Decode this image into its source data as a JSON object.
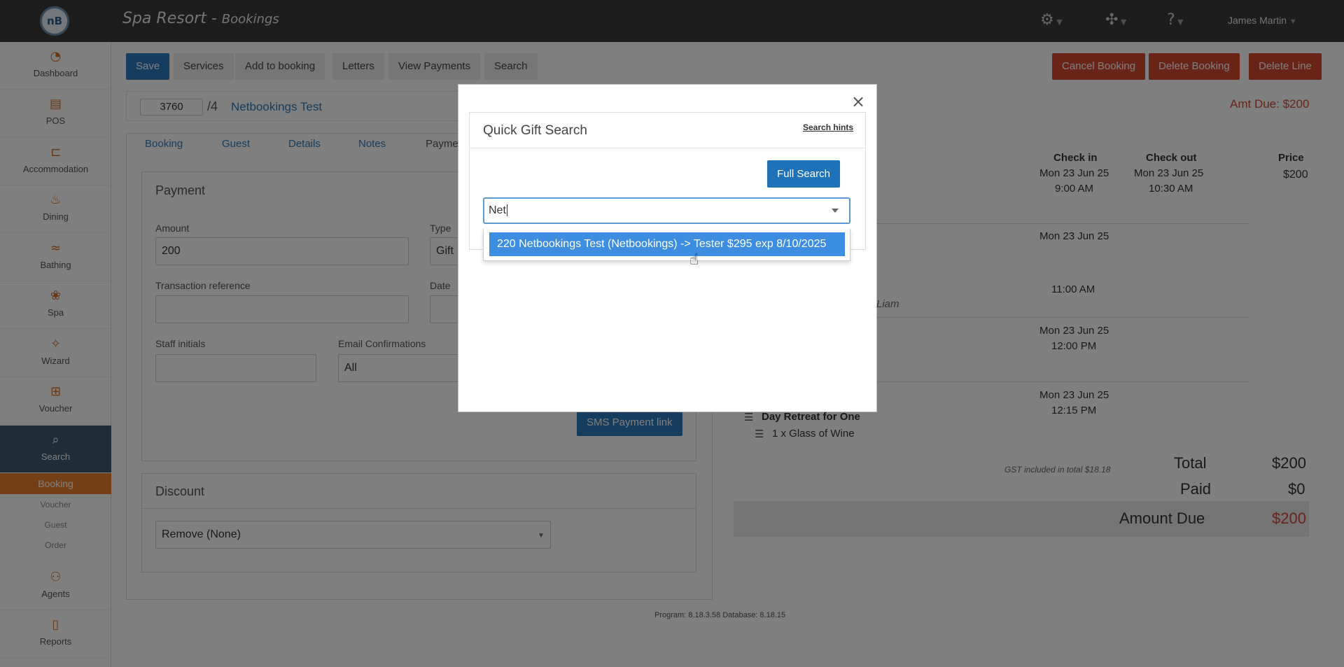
{
  "app": {
    "logo_text": "nB",
    "title": "Spa Resort",
    "subtitle": "Bookings",
    "user": "James Martin"
  },
  "sidebar": {
    "items": [
      {
        "label": "Dashboard",
        "icon": "dashboard-icon"
      },
      {
        "label": "POS",
        "icon": "pos-icon"
      },
      {
        "label": "Accommodation",
        "icon": "bed-icon"
      },
      {
        "label": "Dining",
        "icon": "dining-icon"
      },
      {
        "label": "Bathing",
        "icon": "bathing-icon"
      },
      {
        "label": "Spa",
        "icon": "lotus-icon"
      },
      {
        "label": "Wizard",
        "icon": "wand-icon"
      },
      {
        "label": "Voucher",
        "icon": "gift-icon"
      },
      {
        "label": "Search",
        "icon": "search-icon"
      }
    ],
    "search_sub": [
      "Booking",
      "Voucher",
      "Guest",
      "Order"
    ],
    "items_after": [
      {
        "label": "Agents",
        "icon": "agents-icon"
      },
      {
        "label": "Reports",
        "icon": "reports-icon"
      }
    ]
  },
  "toolbar": {
    "save": "Save",
    "services": "Services",
    "add_to_booking": "Add to booking",
    "letters": "Letters",
    "view_payments": "View Payments",
    "search": "Search",
    "cancel_booking": "Cancel Booking",
    "delete_booking": "Delete Booking",
    "delete_line": "Delete Line"
  },
  "booking": {
    "number": "3760",
    "suffix": "/4",
    "name": "Netbookings Test",
    "amt_due": "Amt Due: $200"
  },
  "tabs": [
    "Booking",
    "Guest",
    "Details",
    "Notes",
    "Payme"
  ],
  "payment": {
    "heading": "Payment",
    "amount_label": "Amount",
    "amount_value": "200",
    "type_label": "Type",
    "type_value": "Gift",
    "txn_label": "Transaction reference",
    "date_label": "Date",
    "staff_label": "Staff initials",
    "email_label": "Email Confirmations",
    "email_value": "All",
    "sms_button": "SMS Payment link"
  },
  "discount": {
    "heading": "Discount",
    "value": "Remove (None)"
  },
  "summary": {
    "col_checkin": "Check in",
    "col_checkout": "Check out",
    "col_price": "Price",
    "row1": {
      "checkin_date": "Mon 23 Jun 25",
      "checkin_time": "9:00 AM",
      "checkout_date": "Mon 23 Jun 25",
      "checkout_time": "10:30 AM",
      "price": "$200"
    },
    "row2": {
      "checkin_date": "Mon 23 Jun 25",
      "time": "11:00 AM",
      "staff_fragment": "Liam"
    },
    "row3": {
      "checkin_date": "Mon 23 Jun 25",
      "checkin_time": "12:00 PM"
    },
    "row4": {
      "checkin_date": "Mon 23 Jun 25",
      "checkin_time": "12:15 PM",
      "item": "Day Retreat for One",
      "subitem": "1 x Glass of Wine"
    },
    "gst": "GST included in total $18.18",
    "total_label": "Total",
    "total_value": "$200",
    "paid_label": "Paid",
    "paid_value": "$0",
    "due_label": "Amount Due",
    "due_value": "$200"
  },
  "footer": "Program: 8.18.3.58 Database: 8.18.15",
  "modal": {
    "close": "×",
    "title": "Quick Gift Search",
    "hints": "Search hints",
    "full_search": "Full Search",
    "query": "Net",
    "option": "220 Netbookings Test (Netbookings) -> Tester $295 exp 8/10/2025"
  },
  "colors": {
    "accent": "#2f7bbd",
    "danger": "#d3472f",
    "highlight": "#3d8ee0",
    "sidebar_active": "#3d5a6f",
    "sub_active": "#e87e2f"
  }
}
